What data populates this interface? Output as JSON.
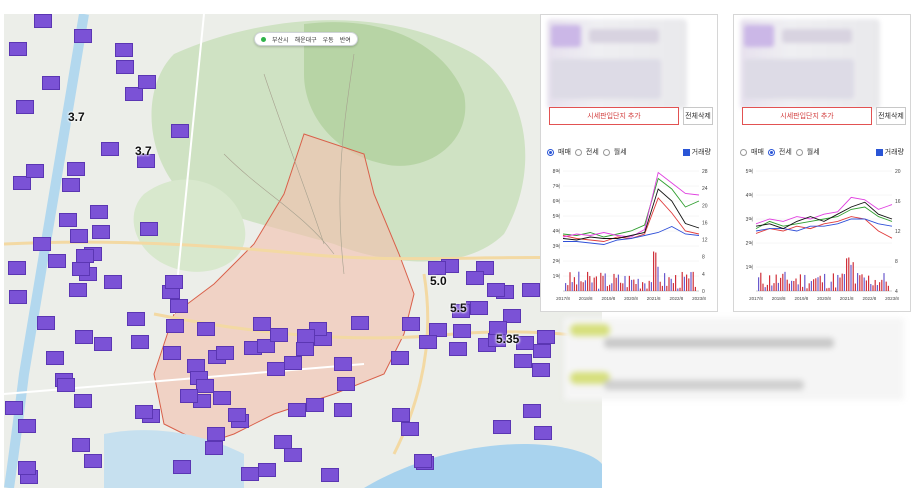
{
  "map": {
    "controls": [
      "부산시",
      "해운대구",
      "우동",
      "반여"
    ],
    "markers_count": 120,
    "labels": [
      "3.7",
      "3.7",
      "5.0",
      "5.5",
      "5.35"
    ],
    "colors": {
      "marker": "#7b52d6",
      "highlight_area": "#f4b7a6",
      "road": "#f3d9a3",
      "water": "#a9d3ee"
    }
  },
  "panels": [
    {
      "add_button": "시세판입단지 추가",
      "delete_button": "전체삭제",
      "options": [
        "매매",
        "전세",
        "월세"
      ],
      "selected": "매매",
      "volume_label": "거래량",
      "chart_data": {
        "type": "line",
        "x": [
          "2017/8",
          "2018/8",
          "2019/8",
          "2020/8",
          "2021/8",
          "2022/8",
          "2023/8"
        ],
        "y_left_ticks": [
          "1억",
          "2억",
          "3억",
          "4억",
          "5억",
          "6억",
          "7억",
          "8억"
        ],
        "y_right_ticks": [
          "0",
          "4",
          "8",
          "12",
          "16",
          "20",
          "24",
          "28"
        ],
        "series": [
          {
            "color": "#e03c3c",
            "values": [
              3.7,
              3.5,
              3.4,
              3.3,
              3.6,
              3.5,
              3.8,
              6.2,
              5.2,
              4.0,
              3.8
            ]
          },
          {
            "color": "#2f9e2f",
            "values": [
              3.8,
              3.7,
              3.9,
              3.6,
              3.8,
              4.0,
              4.4,
              7.5,
              6.8,
              5.6,
              6.0
            ]
          },
          {
            "color": "#e040e0",
            "values": [
              3.6,
              3.8,
              3.7,
              3.9,
              3.7,
              3.6,
              4.1,
              7.9,
              7.2,
              6.5,
              6.4
            ]
          },
          {
            "color": "#3050d8",
            "values": [
              3.3,
              3.3,
              3.2,
              3.1,
              3.4,
              3.5,
              3.7,
              3.9,
              4.3,
              3.8,
              3.7
            ]
          },
          {
            "color": "#111111",
            "values": [
              3.5,
              3.4,
              3.6,
              3.5,
              3.5,
              3.7,
              3.9,
              6.8,
              6.0,
              4.5,
              4.2
            ]
          }
        ],
        "bars_color": "#d0303a"
      }
    },
    {
      "add_button": "시세판입단지 추가",
      "delete_button": "전체삭제",
      "options": [
        "매매",
        "전세",
        "월세"
      ],
      "selected": "전세",
      "volume_label": "거래량",
      "chart_data": {
        "type": "line",
        "x": [
          "2017/8",
          "2018/8",
          "2019/8",
          "2020/8",
          "2021/8",
          "2022/8",
          "2023/8"
        ],
        "y_left_ticks": [
          "1억",
          "2억",
          "3억",
          "4억",
          "5억"
        ],
        "y_right_ticks": [
          "4",
          "8",
          "12",
          "16",
          "20"
        ],
        "series": [
          {
            "color": "#e03c3c",
            "values": [
              2.4,
              2.6,
              2.5,
              2.7,
              2.6,
              2.8,
              2.9,
              3.1,
              3.0,
              2.5,
              2.2
            ]
          },
          {
            "color": "#2f9e2f",
            "values": [
              2.6,
              2.9,
              2.7,
              2.8,
              2.9,
              3.0,
              3.1,
              3.4,
              3.5,
              3.1,
              2.9
            ]
          },
          {
            "color": "#e040e0",
            "values": [
              2.8,
              3.0,
              2.9,
              3.1,
              3.0,
              3.2,
              3.3,
              3.9,
              3.8,
              3.4,
              3.6
            ]
          },
          {
            "color": "#3050d8",
            "values": [
              2.5,
              2.6,
              2.6,
              2.5,
              2.7,
              2.7,
              2.8,
              3.0,
              3.0,
              2.8,
              2.7
            ]
          },
          {
            "color": "#111111",
            "values": [
              2.7,
              2.8,
              2.6,
              2.9,
              3.1,
              2.9,
              3.2,
              3.5,
              3.7,
              3.2,
              3.0
            ]
          }
        ],
        "bars_color": "#d0303a"
      }
    }
  ]
}
